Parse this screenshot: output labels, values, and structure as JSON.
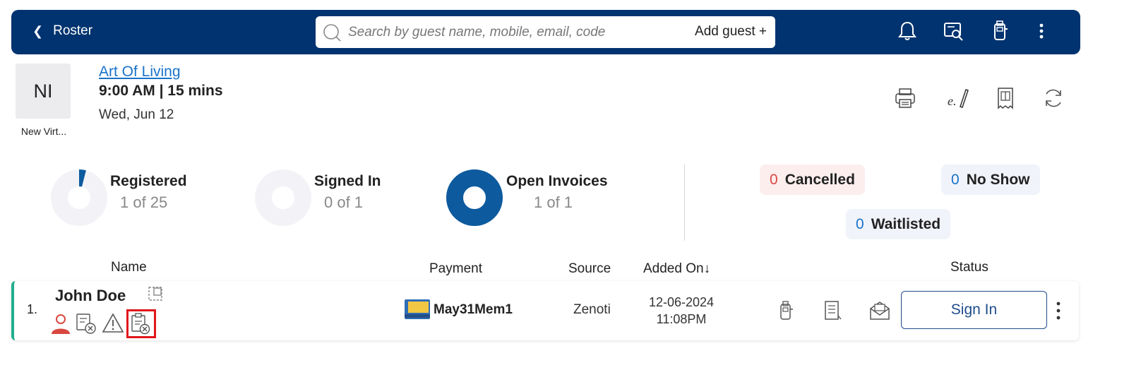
{
  "topbar": {
    "back_label": "Roster",
    "search_placeholder": "Search by guest name, mobile, email, code",
    "add_guest_label": "Add guest +",
    "icons": [
      "bell-icon",
      "id-card-search-icon",
      "card-reader-icon",
      "more-vertical-icon"
    ]
  },
  "class_info": {
    "avatar_initials": "NI",
    "avatar_caption": "New Virt...",
    "title": "Art Of Living",
    "time": "9:00 AM | 15 mins",
    "date": "Wed, Jun 12",
    "actions": [
      "printer-icon",
      "signature-icon",
      "receipt-icon",
      "refresh-icon"
    ]
  },
  "stats": {
    "registered": {
      "label": "Registered",
      "value": "1 of 25",
      "fraction": 0.04
    },
    "signed_in": {
      "label": "Signed In",
      "value": "0 of 1",
      "fraction": 0
    },
    "open_invoices": {
      "label": "Open Invoices",
      "value": "1 of 1",
      "fraction": 1
    },
    "cancelled": {
      "count": "0",
      "label": "Cancelled"
    },
    "no_show": {
      "count": "0",
      "label": "No Show"
    },
    "waitlisted": {
      "count": "0",
      "label": "Waitlisted"
    }
  },
  "table": {
    "headers": {
      "name": "Name",
      "payment": "Payment",
      "source": "Source",
      "added_on": "Added On",
      "sort_arrow": "↓",
      "status": "Status"
    },
    "rows": [
      {
        "index": "1.",
        "name": "John Doe",
        "payment": "May31Mem1",
        "source": "Zenoti",
        "added_date": "12-06-2024",
        "added_time": "11:08PM",
        "action_label": "Sign In"
      }
    ]
  },
  "colors": {
    "topbar": "#00336f",
    "accent_blue": "#1a73c9",
    "donut_fill": "#0d5a9e",
    "cancelled_bg": "#fdeeee",
    "cancelled_num": "#d9473f",
    "status_border": "#1fae8d",
    "highlight": "#e0161b"
  }
}
